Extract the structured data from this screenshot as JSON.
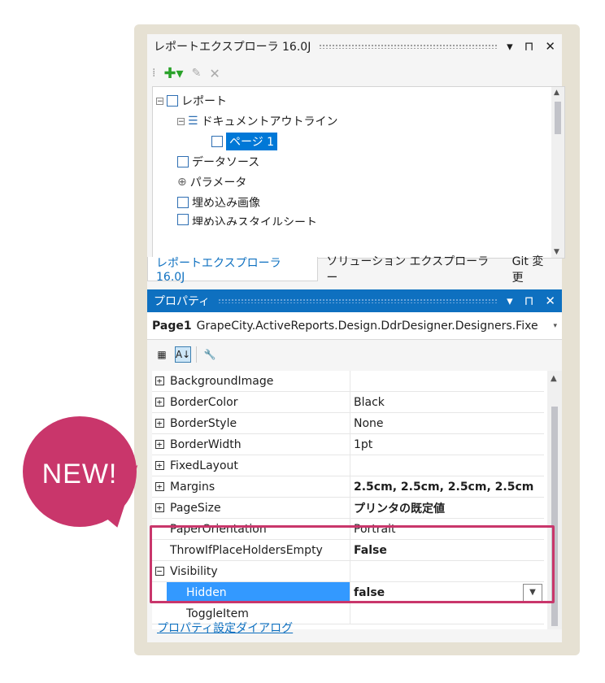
{
  "explorer": {
    "title": "レポートエクスプローラ 16.0J",
    "title_buttons": [
      "▾",
      "⊓",
      "✕"
    ],
    "toolbar_icons": [
      "add-icon",
      "edit-icon",
      "delete-icon"
    ],
    "tree": [
      {
        "label": "レポート",
        "icon": "report-icon"
      },
      {
        "label": "ドキュメントアウトライン",
        "icon": "outline-icon"
      },
      {
        "label": "ページ 1",
        "icon": "page-icon",
        "selected": true
      },
      {
        "label": "データソース",
        "icon": "datasource-icon"
      },
      {
        "label": "パラメータ",
        "icon": "parameter-icon"
      },
      {
        "label": "埋め込み画像",
        "icon": "image-icon"
      },
      {
        "label": "埋め込みスタイルシート",
        "icon": "stylesheet-icon"
      }
    ]
  },
  "tabs": [
    "レポートエクスプローラ 16.0J",
    "ソリューション エクスプローラー",
    "Git 変更"
  ],
  "properties": {
    "title": "プロパティ",
    "object_name": "Page1",
    "object_type": "GrapeCity.ActiveReports.Design.DdrDesigner.Designers.Fixe",
    "rows": [
      {
        "name": "BackgroundImage",
        "value": "",
        "expand": "+"
      },
      {
        "name": "BorderColor",
        "value": "Black",
        "expand": "+"
      },
      {
        "name": "BorderStyle",
        "value": "None",
        "expand": "+"
      },
      {
        "name": "BorderWidth",
        "value": "1pt",
        "expand": "+"
      },
      {
        "name": "FixedLayout",
        "value": "",
        "expand": "+"
      },
      {
        "name": "Margins",
        "value": "2.5cm, 2.5cm, 2.5cm, 2.5cm",
        "expand": "+"
      },
      {
        "name": "PageSize",
        "value": "プリンタの既定値",
        "expand": "+"
      },
      {
        "name": "PaperOrientation",
        "value": "Portrait",
        "expand": ""
      },
      {
        "name": "ThrowIfPlaceHoldersEmpty",
        "value": "False",
        "expand": ""
      },
      {
        "name": "Visibility",
        "value": "",
        "expand": "−"
      },
      {
        "name": "Hidden",
        "value": "false",
        "expand": ""
      },
      {
        "name": "ToggleItem",
        "value": "",
        "expand": ""
      }
    ],
    "dialog_link": "プロパティ設定ダイアログ"
  },
  "badge": {
    "text": "NEW!",
    "color": "#c9366b"
  }
}
